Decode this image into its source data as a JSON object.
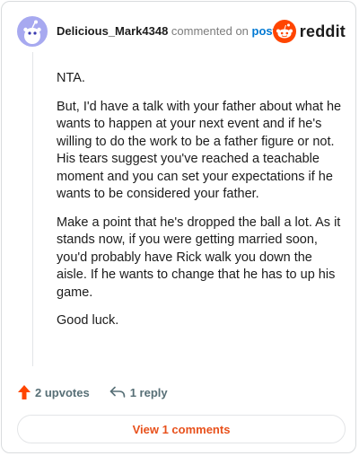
{
  "header": {
    "username": "Delicious_Mark4348",
    "action_text": "commented on",
    "post_link": "post",
    "brand": "reddit"
  },
  "comment": {
    "paragraphs": [
      "NTA.",
      "But, I'd have a talk with your father about what he wants to happen at your next event and if he's willing to do the work to be a father figure or not. His tears suggest you've reached a teachable moment and you can set your expectations if he wants to be considered your father.",
      "Make a point that he's dropped the ball a lot. As it stands now, if you were getting married soon, you'd probably have Rick walk you down the aisle. If he wants to change that he has to up his game.",
      "Good luck."
    ]
  },
  "actions": {
    "upvotes": "2 upvotes",
    "reply": "1 reply"
  },
  "footer": {
    "view_comments": "View 1 comments"
  },
  "colors": {
    "brand_orange": "#ff4500",
    "link_blue": "#0079d3",
    "cta_orange": "#e8511c",
    "muted": "#576f76"
  }
}
